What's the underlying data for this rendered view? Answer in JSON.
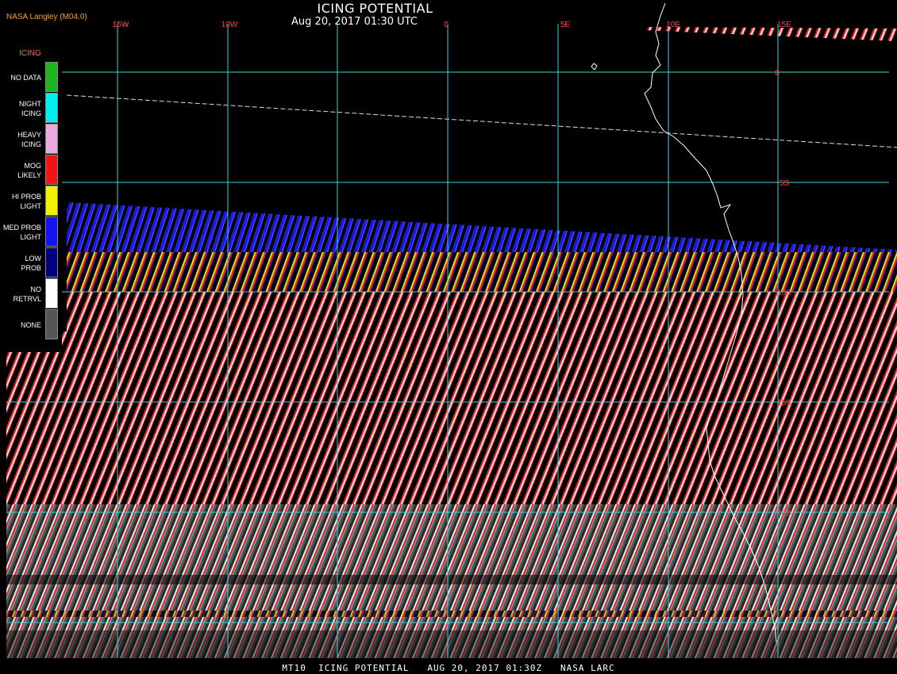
{
  "header": {
    "title": "ICING POTENTIAL",
    "subtitle": "Aug 20, 2017 01:30 UTC",
    "credit": "NASA Langley (M04.0)"
  },
  "footer": {
    "text": "MT10  ICING POTENTIAL   AUG 20, 2017 01:30Z   NASA LARC"
  },
  "legend": {
    "title": "ICING",
    "items": [
      {
        "label": "NO DATA",
        "color": "#1eb41e"
      },
      {
        "label": "NIGHT\nICING",
        "color": "#00f0f0"
      },
      {
        "label": "HEAVY\nICING",
        "color": "#e8aae0"
      },
      {
        "label": "MOG\nLIKELY",
        "color": "#f01414"
      },
      {
        "label": "HI PROB\nLIGHT",
        "color": "#f0f000"
      },
      {
        "label": "MED PROB\nLIGHT",
        "color": "#1414f0"
      },
      {
        "label": "LOW\nPROB",
        "color": "#000080"
      },
      {
        "label": "NO\nRETRVL",
        "color": "#ffffff"
      },
      {
        "label": "NONE",
        "color": "#555555"
      }
    ]
  },
  "grid": {
    "longitude_labels": [
      "15W",
      "10W",
      "0",
      "5E",
      "10E",
      "15E"
    ],
    "latitude_labels": [
      "0",
      "5S",
      "10S",
      "15S",
      "20S"
    ],
    "line_color": "#3fd0d8",
    "label_color": "#ff4a3a"
  },
  "imagery": {
    "colors": {
      "medium_prob": "#1a1ae0",
      "mog_likely": "#e82020",
      "hi_prob": "#e0e020",
      "no_retrieval": "#e8e8e8",
      "none": "#606060"
    }
  }
}
